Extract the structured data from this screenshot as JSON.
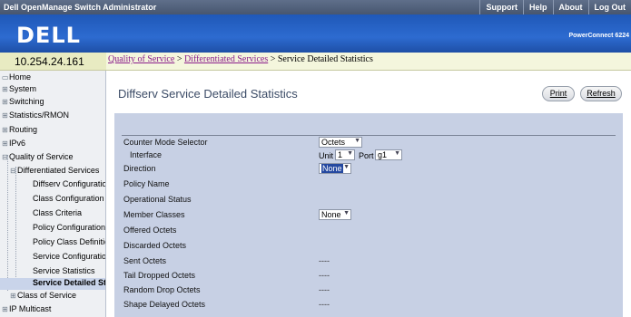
{
  "header": {
    "app_title": "Dell OpenManage Switch Administrator",
    "menu": [
      "Support",
      "Help",
      "About",
      "Log Out"
    ],
    "logo_text": "DELL",
    "model": "PowerConnect 6224"
  },
  "ip_address": "10.254.24.161",
  "breadcrumb": {
    "link1": "Quality of Service",
    "link2": "Differentiated Services",
    "sep": ">",
    "current": "Service Detailed Statistics"
  },
  "sidebar": {
    "items": [
      "Home",
      "System",
      "Switching",
      "Statistics/RMON",
      "Routing",
      "IPv6",
      "Quality of Service",
      "Differentiated Services",
      "Diffserv Configuration",
      "Class Configuration",
      "Class Criteria",
      "Policy Configuration",
      "Policy Class Definition",
      "Service Configuration",
      "Service Statistics",
      "Service Detailed Statistics",
      "Class of Service",
      "IP Multicast"
    ]
  },
  "page": {
    "title": "Diffserv Service Detailed Statistics",
    "print_label": "Print",
    "refresh_label": "Refresh"
  },
  "form": {
    "counter_mode_label": "Counter Mode Selector",
    "counter_mode_value": "Octets",
    "interface_label": "Interface",
    "unit_label": "Unit",
    "unit_value": "1",
    "port_label": "Port",
    "port_value": "g1",
    "direction_label": "Direction",
    "direction_value": "None",
    "policy_name_label": "Policy Name",
    "operational_status_label": "Operational Status",
    "member_classes_label": "Member Classes",
    "member_classes_value": "None",
    "offered_octets_label": "Offered Octets",
    "discarded_octets_label": "Discarded Octets",
    "sent_octets_label": "Sent Octets",
    "sent_octets_value": "----",
    "tail_dropped_label": "Tail Dropped Octets",
    "tail_dropped_value": "----",
    "random_drop_label": "Random Drop Octets",
    "random_drop_value": "----",
    "shape_delayed_label": "Shape Delayed Octets",
    "shape_delayed_value": "----"
  }
}
